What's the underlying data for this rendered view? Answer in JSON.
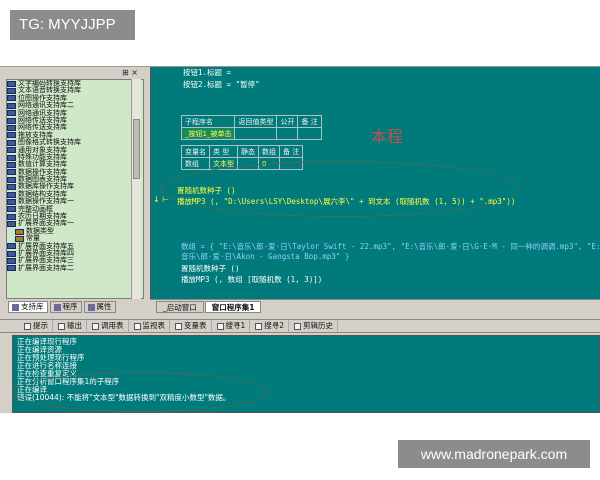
{
  "overlay": {
    "tag": "TG: MYYJJPP",
    "url": "www.madronepark.com"
  },
  "left_panel": {
    "toolbar_glyphs": "⊞ ×",
    "tree": [
      {
        "label": "文字编码转换支持库",
        "indent": false
      },
      {
        "label": "文本语音转换支持库",
        "indent": false
      },
      {
        "label": "位图操作支持库",
        "indent": false
      },
      {
        "label": "网络通讯支持库二",
        "indent": false
      },
      {
        "label": "网络通讯支持库",
        "indent": false
      },
      {
        "label": "网络传送支持库",
        "indent": false
      },
      {
        "label": "网络传送支持库",
        "indent": false
      },
      {
        "label": "拖放支持库",
        "indent": false
      },
      {
        "label": "图像格式转换支持库",
        "indent": false
      },
      {
        "label": "通用对象支持库",
        "indent": false
      },
      {
        "label": "特殊功能支持库",
        "indent": false
      },
      {
        "label": "数值计算支持库",
        "indent": false
      },
      {
        "label": "数据操作支持库",
        "indent": false
      },
      {
        "label": "数据图表支持库",
        "indent": false
      },
      {
        "label": "数据库操作支持库",
        "indent": false
      },
      {
        "label": "数据结构支持库",
        "indent": false
      },
      {
        "label": "数据操作支持库一",
        "indent": false
      },
      {
        "label": "完整动画框",
        "indent": false
      },
      {
        "label": "农历日期支持库",
        "indent": false
      },
      {
        "label": "扩展界面支持库一",
        "indent": false
      },
      {
        "label": "数据类型",
        "indent": true
      },
      {
        "label": "常量",
        "indent": true
      },
      {
        "label": "扩展界面支持库五",
        "indent": false
      },
      {
        "label": "扩展界面支持库四",
        "indent": false
      },
      {
        "label": "扩展界面支持库三",
        "indent": false
      },
      {
        "label": "扩展界面支持库二",
        "indent": false
      }
    ],
    "tabs": [
      "支持库",
      "程序",
      "属性"
    ]
  },
  "editor": {
    "line1": "按钮1.标题 =",
    "line2": "按钮2.标题 = \"暂停\"",
    "sub_table": {
      "headers": [
        "子程序名",
        "返回值类型",
        "公开",
        "备 注"
      ],
      "row": [
        "_按钮1_被单击",
        "",
        "",
        ""
      ]
    },
    "var_table": {
      "headers": [
        "变量名",
        "类 型",
        "静态",
        "数组",
        "备 注"
      ],
      "row": [
        "数组",
        "文本型",
        "",
        "0",
        ""
      ]
    },
    "watermark_char": "本程",
    "line3": "置随机数种子 ()",
    "line4": "播放MP3 (, \"D:\\Users\\LSY\\Desktop\\展六李\\\" + 到文本 (取随机数 (1, 5)) + \".mp3\"))",
    "line5": "数组 = { \"E:\\音乐\\郎·爱·日\\Taylor Swift - 22.mp3\", \"E:\\音乐\\郎·爱·日\\G·E·M - 同一种的调调.mp3\", \"E:\\",
    "line6": "音乐\\郎·爱·日\\Akon - Gangsta Bop.mp3\" }",
    "line7": "置随机数种子 ()",
    "line8": "播放MP3 (, 数组 [取随机数 (1, 3)])",
    "tabs": [
      "_启动窗口",
      "窗口程序集1"
    ]
  },
  "output": {
    "toolbar": [
      "提示",
      "输出",
      "调用表",
      "监视表",
      "变量表",
      "搜寻1",
      "搜寻2",
      "剪辑历史"
    ],
    "lines": [
      "正在编译现行程序",
      "正在编译资源",
      "正在预处理现行程序",
      "正在进行名称连接",
      "正在检查重复定义",
      "正在分析窗口程序集1的子程序",
      "正在编译",
      "错误(10044): 不能将\"文本型\"数据转换到\"双精度小数型\"数据。"
    ]
  }
}
